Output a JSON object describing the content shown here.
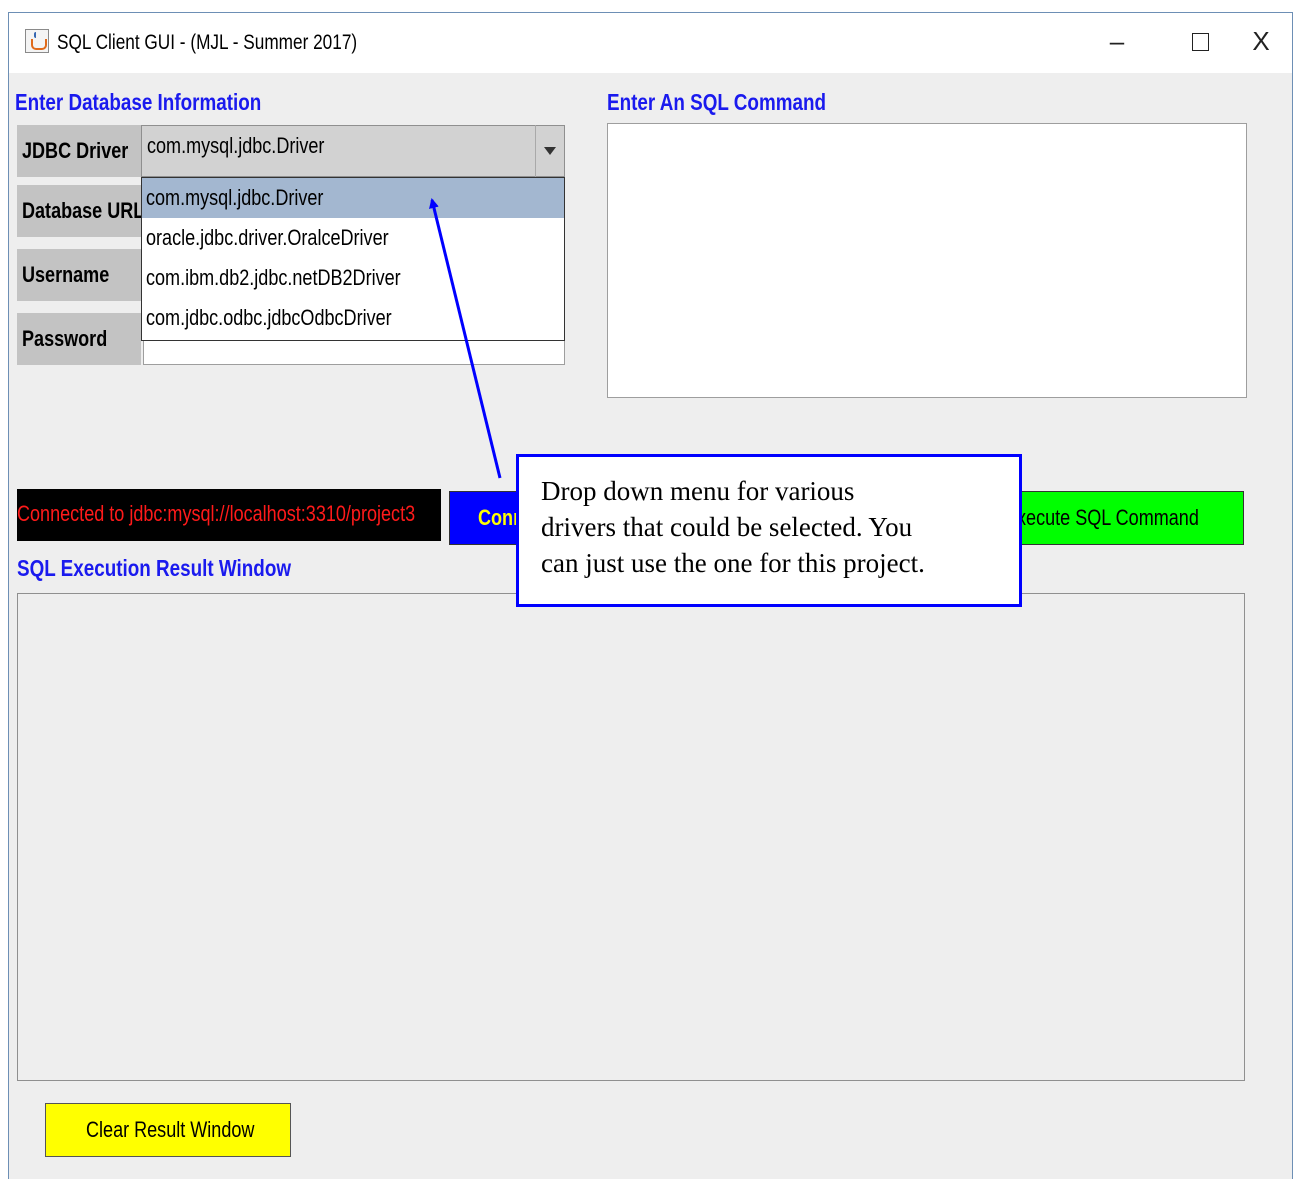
{
  "window": {
    "title": "SQL Client GUI - (MJL - Summer 2017)",
    "icon": "java-coffee-cup-icon",
    "controls": {
      "minimize": "–",
      "maximize": "☐",
      "close": "X"
    }
  },
  "database_panel": {
    "title": "Enter Database Information",
    "labels": {
      "driver": "JDBC Driver",
      "url": "Database URL",
      "username": "Username",
      "password": "Password"
    },
    "driver_selected": "com.mysql.jdbc.Driver",
    "driver_options": [
      "com.mysql.jdbc.Driver",
      "oracle.jdbc.driver.OralceDriver",
      "com.ibm.db2.jdbc.netDB2Driver",
      "com.jdbc.odbc.jdbcOdbcDriver"
    ],
    "password_mask": "••••"
  },
  "sql_panel": {
    "title": "Enter An SQL Command",
    "command_text": ""
  },
  "status": {
    "connection_text": "Connected to jdbc:mysql://localhost:3310/project3",
    "connection_color": "#ff1a1a"
  },
  "buttons": {
    "connect_partial": "Conn",
    "execute_partial": "Execute SQL Command",
    "clear": "Clear Result Window"
  },
  "result_panel": {
    "title": "SQL Execution Result Window"
  },
  "annotation": {
    "text": "Drop down menu for various\ndrivers that could be selected.  You\ncan just use the one for this project.",
    "color": "#0000ff"
  }
}
